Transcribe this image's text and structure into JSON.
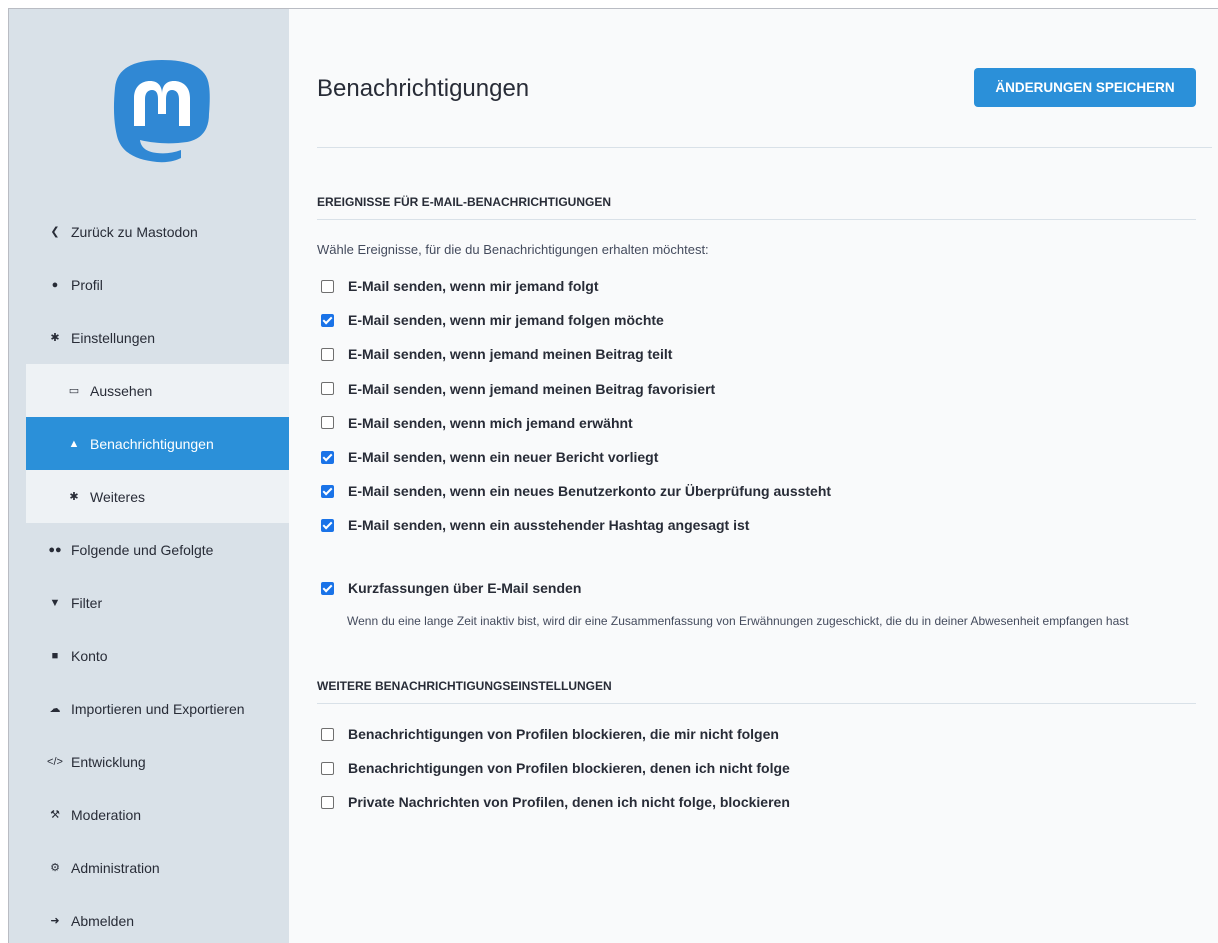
{
  "sidebar": {
    "items": [
      {
        "icon": "chevron-left-icon",
        "glyph": "❮",
        "label": "Zurück zu Mastodon"
      },
      {
        "icon": "user-icon",
        "glyph": "●",
        "label": "Profil"
      },
      {
        "icon": "gear-icon",
        "glyph": "✱",
        "label": "Einstellungen"
      }
    ],
    "subitems": [
      {
        "icon": "desktop-icon",
        "glyph": "▭",
        "label": "Aussehen"
      },
      {
        "icon": "bell-icon",
        "glyph": "▲",
        "label": "Benachrichtigungen",
        "active": true
      },
      {
        "icon": "gear-icon",
        "glyph": "✱",
        "label": "Weiteres"
      }
    ],
    "items_after": [
      {
        "icon": "users-icon",
        "glyph": "●●",
        "label": "Folgende und Gefolgte"
      },
      {
        "icon": "filter-icon",
        "glyph": "▼",
        "label": "Filter"
      },
      {
        "icon": "lock-icon",
        "glyph": "■",
        "label": "Konto"
      },
      {
        "icon": "cloud-upload-icon",
        "glyph": "☁",
        "label": "Importieren und Exportieren"
      },
      {
        "icon": "code-icon",
        "glyph": "</>",
        "label": "Entwicklung"
      },
      {
        "icon": "gavel-icon",
        "glyph": "⚒",
        "label": "Moderation"
      },
      {
        "icon": "cogs-icon",
        "glyph": "⚙",
        "label": "Administration"
      },
      {
        "icon": "sign-out-icon",
        "glyph": "➜",
        "label": "Abmelden"
      }
    ]
  },
  "header": {
    "title": "Benachrichtigungen",
    "save_label": "ÄNDERUNGEN SPEICHERN"
  },
  "email_section": {
    "heading": "EREIGNISSE FÜR E-MAIL-BENACHRICHTIGUNGEN",
    "hint": "Wähle Ereignisse, für die du Benachrichtigungen erhalten möchtest:",
    "options": [
      {
        "label": "E-Mail senden, wenn mir jemand folgt",
        "checked": false
      },
      {
        "label": "E-Mail senden, wenn mir jemand folgen möchte",
        "checked": true
      },
      {
        "label": "E-Mail senden, wenn jemand meinen Beitrag teilt",
        "checked": false
      },
      {
        "label": "E-Mail senden, wenn jemand meinen Beitrag favorisiert",
        "checked": false
      },
      {
        "label": "E-Mail senden, wenn mich jemand erwähnt",
        "checked": false
      },
      {
        "label": "E-Mail senden, wenn ein neuer Bericht vorliegt",
        "checked": true
      },
      {
        "label": "E-Mail senden, wenn ein neues Benutzerkonto zur Überprüfung aussteht",
        "checked": true
      },
      {
        "label": "E-Mail senden, wenn ein ausstehender Hashtag angesagt ist",
        "checked": true
      }
    ],
    "digest": {
      "label": "Kurzfassungen über E-Mail senden",
      "checked": true,
      "hint": "Wenn du eine lange Zeit inaktiv bist, wird dir eine Zusammenfassung von Erwähnungen zugeschickt, die du in deiner Abwesenheit empfangen hast"
    }
  },
  "other_section": {
    "heading": "WEITERE BENACHRICHTIGUNGSEINSTELLUNGEN",
    "options": [
      {
        "label": "Benachrichtigungen von Profilen blockieren, die mir nicht folgen",
        "checked": false
      },
      {
        "label": "Benachrichtigungen von Profilen blockieren, denen ich nicht folge",
        "checked": false
      },
      {
        "label": "Private Nachrichten von Profilen, denen ich nicht folge, blockieren",
        "checked": false
      }
    ]
  },
  "colors": {
    "accent": "#2b90d9",
    "sidebar_bg": "#d9e1e8",
    "checkbox_checked": "#1a73e8"
  }
}
